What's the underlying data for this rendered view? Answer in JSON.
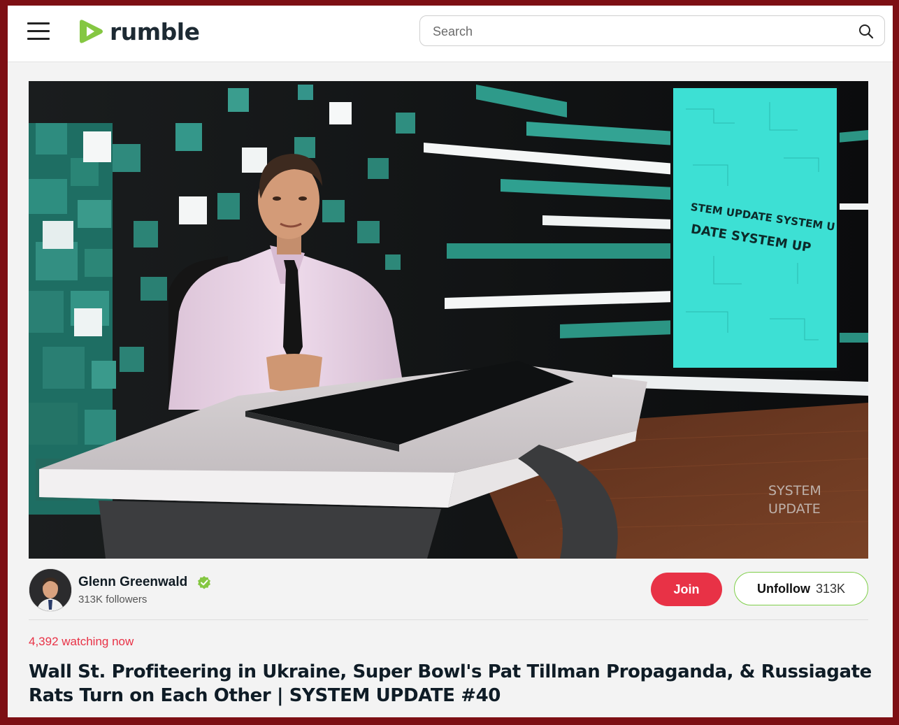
{
  "header": {
    "logo_text": "rumble",
    "search_placeholder": "Search"
  },
  "video": {
    "screen_text_line1": "STEM UPDATE SYSTEM U",
    "screen_text_line2": "DATE SYSTEM UP",
    "watermark_line1": "SYSTEM",
    "watermark_line2": "UPDATE"
  },
  "channel": {
    "name": "Glenn Greenwald",
    "followers": "313K followers",
    "join_label": "Join",
    "unfollow_label": "Unfollow",
    "unfollow_count": "313K"
  },
  "stream": {
    "watching": "4,392 watching now",
    "title": "Wall St. Profiteering in Ukraine, Super Bowl's Pat Tillman Propaganda, & Russiagate Rats Turn on Each Other | SYSTEM UPDATE #40"
  },
  "colors": {
    "brand_green": "#85c742",
    "join_red": "#e83246",
    "frame_red": "#7d0f14"
  }
}
